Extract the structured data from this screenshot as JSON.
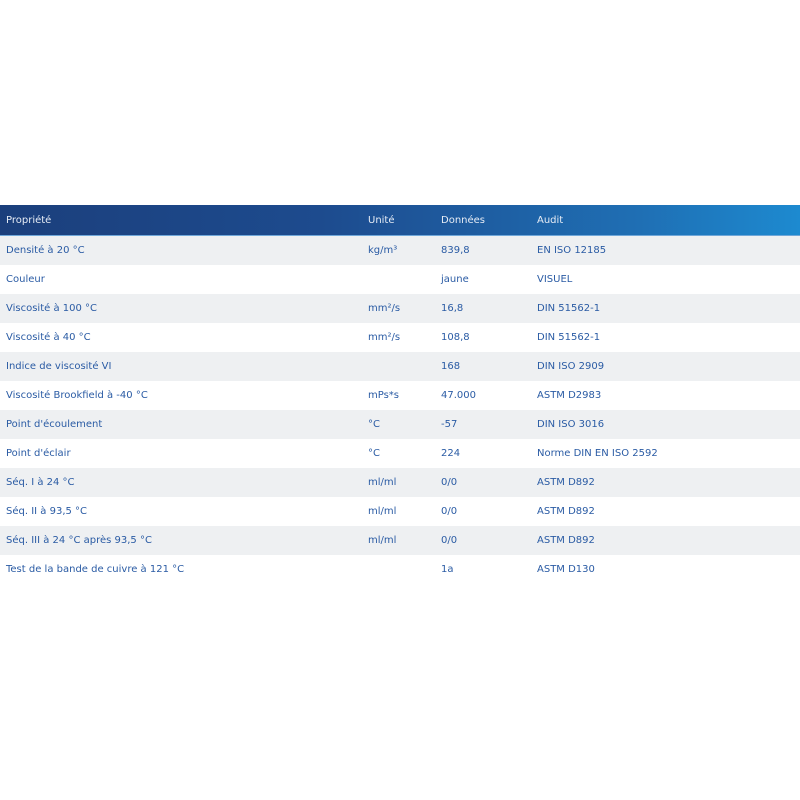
{
  "table": {
    "headers": {
      "property": "Propriété",
      "unit": "Unité",
      "data": "Données",
      "audit": "Audit"
    },
    "rows": [
      {
        "property": "Densité à 20 °C",
        "unit": "kg/m³",
        "value": "839,8",
        "audit": "EN ISO 12185"
      },
      {
        "property": "Couleur",
        "unit": "",
        "value": "jaune",
        "audit": "VISUEL"
      },
      {
        "property": "Viscosité à 100 °C",
        "unit": "mm²/s",
        "value": "16,8",
        "audit": "DIN 51562-1"
      },
      {
        "property": "Viscosité à 40 °C",
        "unit": "mm²/s",
        "value": "108,8",
        "audit": "DIN 51562-1"
      },
      {
        "property": "Indice de viscosité VI",
        "unit": "",
        "value": "168",
        "audit": "DIN ISO 2909"
      },
      {
        "property": "Viscosité Brookfield à -40 °C",
        "unit": "mPs*s",
        "value": "47.000",
        "audit": "ASTM D2983"
      },
      {
        "property": "Point d'écoulement",
        "unit": "°C",
        "value": "-57",
        "audit": "DIN ISO 3016"
      },
      {
        "property": "Point d'éclair",
        "unit": "°C",
        "value": "224",
        "audit": "Norme DIN EN ISO 2592"
      },
      {
        "property": "Séq. I à 24 °C",
        "unit": "ml/ml",
        "value": "0/0",
        "audit": "ASTM D892"
      },
      {
        "property": "Séq. II à 93,5 °C",
        "unit": "ml/ml",
        "value": "0/0",
        "audit": "ASTM D892"
      },
      {
        "property": "Séq. III à 24 °C après 93,5 °C",
        "unit": "ml/ml",
        "value": "0/0",
        "audit": "ASTM D892"
      },
      {
        "property": "Test de la bande de cuivre à 121 °C",
        "unit": "",
        "value": "1a",
        "audit": "ASTM D130"
      }
    ]
  },
  "colors": {
    "header_start": "#1b3f7c",
    "header_end": "#1d8ad0",
    "text": "#2a5ba4",
    "stripe": "#eef0f2"
  }
}
